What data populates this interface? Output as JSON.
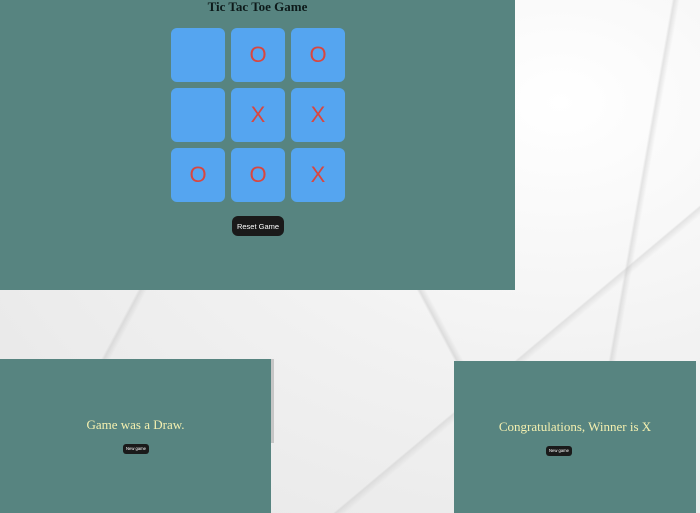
{
  "main": {
    "title": "Tic Tac Toe Game",
    "board": [
      "",
      "O",
      "O",
      "",
      "X",
      "X",
      "O",
      "O",
      "X"
    ],
    "reset_label": "Reset Game"
  },
  "draw_screen": {
    "message": "Game was a Draw.",
    "new_game_label": "New game"
  },
  "win_screen": {
    "message": "Congratulations, Winner is X",
    "new_game_label": "New game"
  },
  "colors": {
    "panel_bg": "#578480",
    "cell_bg": "#55a5f0",
    "mark": "#d9463f",
    "button_bg": "#1a1a1a",
    "message_text": "#f4f0b0"
  }
}
